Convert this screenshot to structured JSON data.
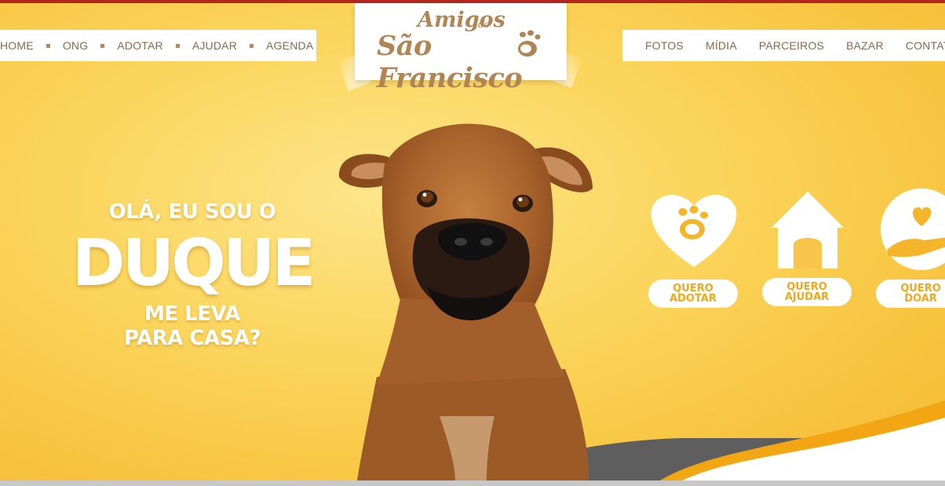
{
  "nav": {
    "left": [
      "HOME",
      "ONG",
      "ADOTAR",
      "AJUDAR",
      "AGENDA"
    ],
    "right": [
      "FOTOS",
      "MÍDIA",
      "PARCEIROS",
      "BAZAR",
      "CONTATO"
    ]
  },
  "logo": {
    "line1": "Amigos",
    "small": "de",
    "line2": "São Francisco"
  },
  "hero": {
    "greeting": "OLÁ, EU SOU O",
    "name": "DUQUE",
    "tagline_1": "ME LEVA",
    "tagline_2": "PARA CASA?"
  },
  "actions": [
    {
      "label": "QUERO\nADOTAR",
      "icon": "heart-paw-icon"
    },
    {
      "label": "QUERO\nAJUDAR",
      "icon": "doghouse-icon"
    },
    {
      "label": "QUERO\nDOAR",
      "icon": "hand-heart-icon"
    }
  ],
  "colors": {
    "accent": "#f2a71a",
    "brand_brown": "#b18553",
    "top_stripe": "#b3261e",
    "background": "#fbd55c"
  }
}
